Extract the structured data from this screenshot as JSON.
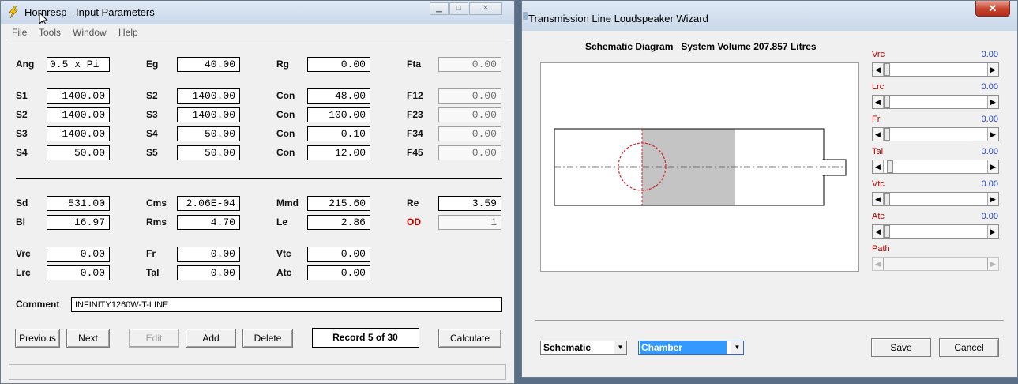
{
  "left_window": {
    "title": "Hornresp - Input Parameters",
    "menu": [
      "File",
      "Tools",
      "Window",
      "Help"
    ],
    "fields": {
      "Ang": "0.5 x Pi",
      "Eg": "40.00",
      "Rg": "0.00",
      "Fta": "0.00",
      "S1a": "1400.00",
      "S2a": "1400.00",
      "Con1": "48.00",
      "F12": "0.00",
      "S2b": "1400.00",
      "S3a": "1400.00",
      "Con2": "100.00",
      "F23": "0.00",
      "S3b": "1400.00",
      "S4a": "50.00",
      "Con3": "0.10",
      "F34": "0.00",
      "S4b": "50.00",
      "S5": "50.00",
      "Con4": "12.00",
      "F45": "0.00",
      "Sd": "531.00",
      "Cms": "2.06E-04",
      "Mmd": "215.60",
      "Re": "3.59",
      "Bl": "16.97",
      "Rms": "4.70",
      "Le": "2.86",
      "OD": "1",
      "Vrc": "0.00",
      "Fr": "0.00",
      "Vtc": "0.00",
      "Lrc": "0.00",
      "Tal": "0.00",
      "Atc": "0.00",
      "Comment": "INFINITY1260W-T-LINE"
    },
    "labels": {
      "Ang": "Ang",
      "Eg": "Eg",
      "Rg": "Rg",
      "Fta": "Fta",
      "S1": "S1",
      "S2": "S2",
      "Con": "Con",
      "F12": "F12",
      "S3": "S3",
      "F23": "F23",
      "S4": "S4",
      "F34": "F34",
      "S5": "S5",
      "F45": "F45",
      "Sd": "Sd",
      "Cms": "Cms",
      "Mmd": "Mmd",
      "Re": "Re",
      "Bl": "Bl",
      "Rms": "Rms",
      "Le": "Le",
      "OD": "OD",
      "Vrc": "Vrc",
      "Fr": "Fr",
      "Vtc": "Vtc",
      "Lrc": "Lrc",
      "Tal": "Tal",
      "Atc": "Atc",
      "Comment": "Comment"
    },
    "buttons": {
      "previous": "Previous",
      "next": "Next",
      "edit": "Edit",
      "add": "Add",
      "delete": "Delete",
      "record": "Record 5 of 30",
      "calculate": "Calculate"
    }
  },
  "right_window": {
    "title": "Transmission Line Loudspeaker Wizard",
    "heading": "Schematic Diagram   System Volume 207.857 Litres",
    "sliders": [
      {
        "label": "Vrc",
        "value": "0.00",
        "position": 0.0,
        "enabled": true
      },
      {
        "label": "Lrc",
        "value": "0.00",
        "position": 0.0,
        "enabled": true
      },
      {
        "label": "Fr",
        "value": "0.00",
        "position": 0.0,
        "enabled": true
      },
      {
        "label": "Tal",
        "value": "0.00",
        "position": 0.03,
        "enabled": true
      },
      {
        "label": "Vtc",
        "value": "0.00",
        "position": 0.0,
        "enabled": true
      },
      {
        "label": "Atc",
        "value": "0.00",
        "position": 0.0,
        "enabled": true
      },
      {
        "label": "Path",
        "value": "",
        "position": 0.0,
        "enabled": false
      }
    ],
    "view_select": "Schematic",
    "part_select": "Chamber",
    "save": "Save",
    "cancel": "Cancel"
  },
  "colors": {
    "slider_label": "#b00000",
    "slider_value": "#1f3fb3",
    "chamber_fill": "#c4c4c4",
    "driver_circle": "#e0202a",
    "selection": "#3399ff"
  }
}
